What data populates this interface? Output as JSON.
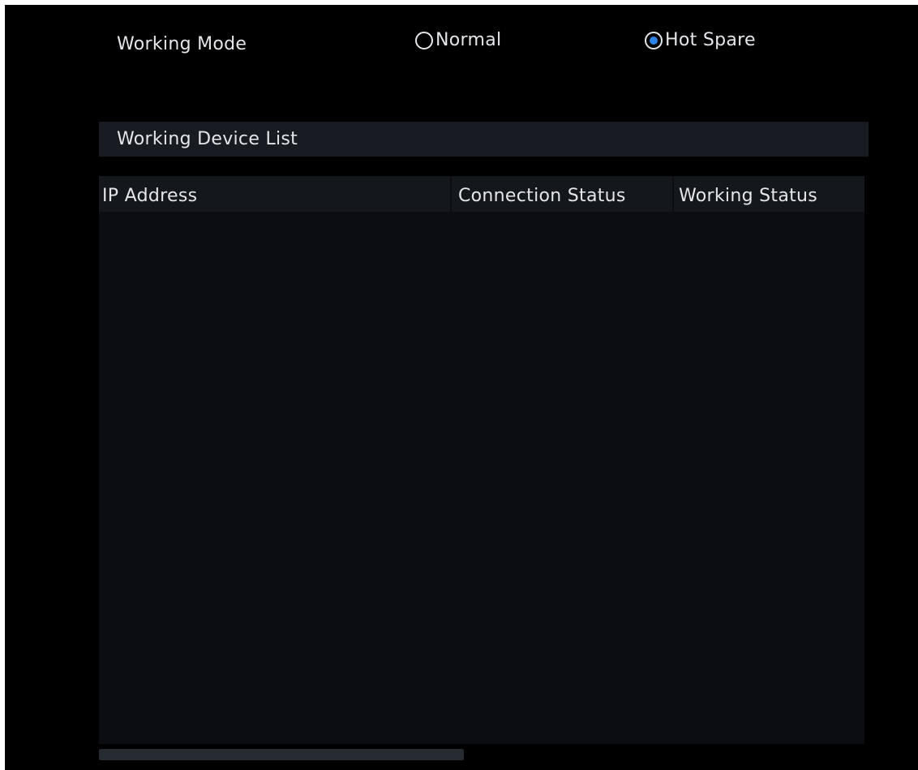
{
  "working_mode": {
    "label": "Working Mode",
    "options": [
      {
        "label": "Normal",
        "selected": false
      },
      {
        "label": "Hot Spare",
        "selected": true
      }
    ]
  },
  "device_list": {
    "title": "Working Device List",
    "columns": [
      "IP Address",
      "Connection Status",
      "Working Status"
    ],
    "rows": []
  },
  "colors": {
    "background": "#000000",
    "panel": "#181b21",
    "text": "#e4e6ea",
    "accent": "#2e84e6"
  }
}
